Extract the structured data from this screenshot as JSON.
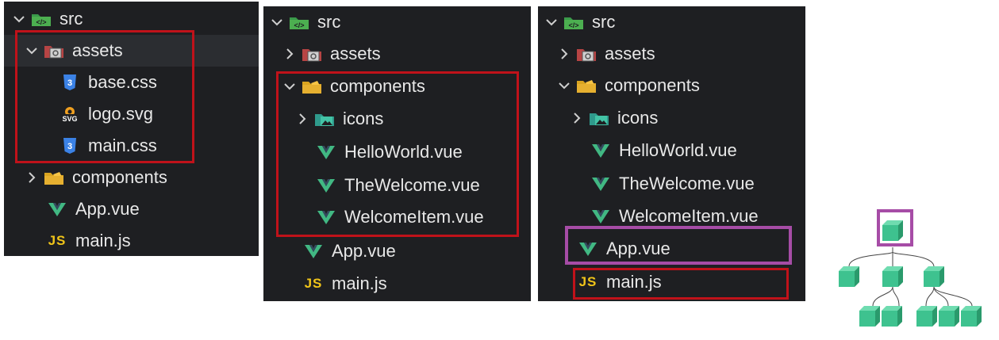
{
  "panel1": {
    "src": "src",
    "assets": "assets",
    "base_css": "base.css",
    "logo_svg": "logo.svg",
    "main_css": "main.css",
    "components": "components",
    "app_vue": "App.vue",
    "main_js": "main.js"
  },
  "panel2": {
    "src": "src",
    "assets": "assets",
    "components": "components",
    "icons": "icons",
    "hello": "HelloWorld.vue",
    "welcome": "TheWelcome.vue",
    "welcome_item": "WelcomeItem.vue",
    "app_vue": "App.vue",
    "main_js": "main.js"
  },
  "panel3": {
    "src": "src",
    "assets": "assets",
    "components": "components",
    "icons": "icons",
    "hello": "HelloWorld.vue",
    "welcome": "TheWelcome.vue",
    "welcome_item": "WelcomeItem.vue",
    "app_vue": "App.vue",
    "main_js": "main.js"
  },
  "icon_labels": {
    "js": "JS",
    "svg": "SVG"
  },
  "colors": {
    "panel_bg": "#1e1f22",
    "highlight_red": "#c0121a",
    "highlight_purple": "#a64ca6",
    "vue_green": "#41b883",
    "css_blue": "#3b82e6",
    "js_yellow": "#f0c419",
    "cube_green": "#3ec28f"
  }
}
